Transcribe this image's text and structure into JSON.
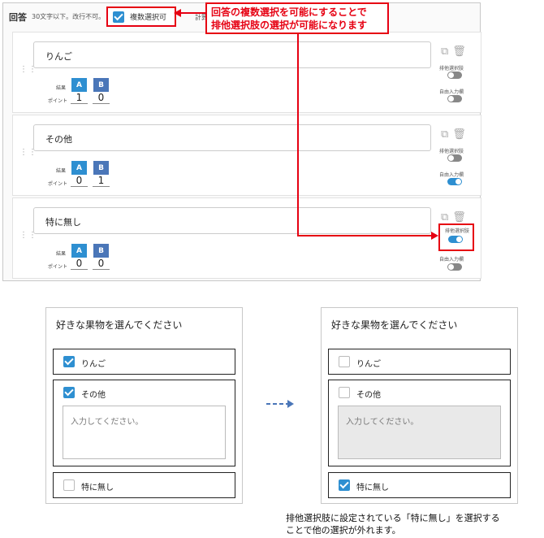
{
  "editor": {
    "section_label": "回答",
    "hint": "30文字以下。改行不可。",
    "multi_select_label": "複数選択可",
    "calc_label_cut": "計算",
    "callout": {
      "line1": "回答の複数選択を可能にすることで",
      "line2": "排他選択肢の選択が可能になります"
    },
    "result_label": "結果",
    "point_label": "ポイント",
    "btn_a": "A",
    "btn_b": "B",
    "exclusive_label": "排他選択肢",
    "free_input_label": "自由入力欄",
    "options": [
      {
        "text": "りんご",
        "point_a": "1",
        "point_b": "0",
        "exclusive": false,
        "free_input": false
      },
      {
        "text": "その他",
        "point_a": "0",
        "point_b": "1",
        "exclusive": false,
        "free_input": true
      },
      {
        "text": "特に無し",
        "point_a": "0",
        "point_b": "0",
        "exclusive": true,
        "free_input": false
      }
    ]
  },
  "preview_before": {
    "question": "好きな果物を選んでください",
    "choices": [
      "りんご",
      "その他",
      "特に無し"
    ],
    "checked": [
      true,
      true,
      false
    ],
    "placeholder": "入力してください。"
  },
  "preview_after": {
    "question": "好きな果物を選んでください",
    "choices": [
      "りんご",
      "その他",
      "特に無し"
    ],
    "checked": [
      false,
      false,
      true
    ],
    "placeholder": "入力してください。"
  },
  "caption": {
    "line1": "排他選択肢に設定されている「特に無し」を選択する",
    "line2": "ことで他の選択が外れます。"
  },
  "colors": {
    "accent": "#2e8fd1",
    "button_b": "#4a76b8",
    "highlight": "#e60012"
  }
}
